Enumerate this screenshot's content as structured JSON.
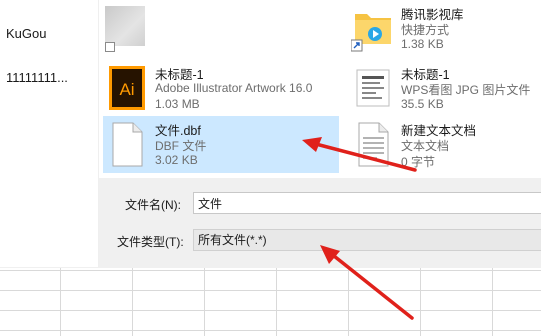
{
  "sidebar": {
    "items": [
      {
        "label": "KuGou"
      },
      {
        "label": "11111111..."
      }
    ]
  },
  "files": [
    {
      "name": "",
      "line2": "",
      "line3": "",
      "icon": "blurred-thumbnail-icon"
    },
    {
      "name": "腾讯影视库",
      "line2": "快捷方式",
      "line3": "1.38 KB",
      "icon": "folder-shortcut-icon"
    },
    {
      "name": "未标题-1",
      "line2": "Adobe Illustrator Artwork 16.0",
      "line3": "1.03 MB",
      "icon": "illustrator-file-icon",
      "icon_text": "Ai"
    },
    {
      "name": "未标题-1",
      "line2": "WPS看图 JPG 图片文件",
      "line3": "35.5 KB",
      "icon": "jpg-image-icon"
    },
    {
      "name": "文件.dbf",
      "line2": "DBF 文件",
      "line3": "3.02 KB",
      "icon": "blank-file-icon",
      "selected": true
    },
    {
      "name": "新建文本文档",
      "line2": "文本文档",
      "line3": "0 字节",
      "icon": "text-document-icon"
    }
  ],
  "filename": {
    "label": "文件名(N):",
    "value": "文件"
  },
  "filetype": {
    "label": "文件类型(T):",
    "value": "所有文件(*.*)"
  },
  "colors": {
    "selection": "#cce8ff",
    "arrow": "#e0211b",
    "ai_brand": "#ff9a00"
  }
}
